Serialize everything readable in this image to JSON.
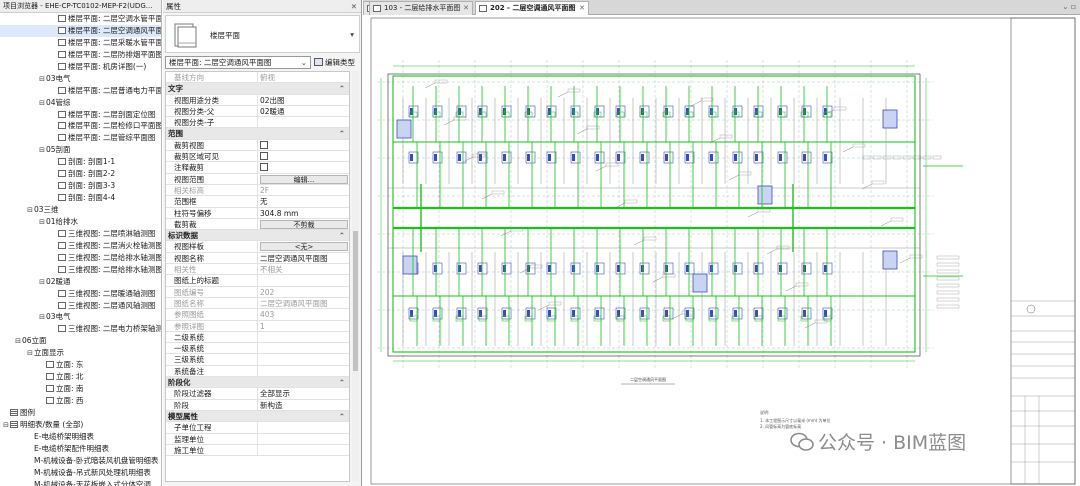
{
  "project_browser": {
    "title": "项目浏览器 - EHE-CP-TC0102-MEP-F2(UDG...",
    "items": [
      {
        "depth": 4,
        "icon": "view",
        "label": "楼层平面: 二层空调水管平面图"
      },
      {
        "depth": 4,
        "icon": "view",
        "label": "楼层平面: 二层空调通风平面图",
        "highlight": true
      },
      {
        "depth": 4,
        "icon": "view",
        "label": "楼层平面: 二层采暖水管平面图"
      },
      {
        "depth": 4,
        "icon": "view",
        "label": "楼层平面: 二层防排烟平面图"
      },
      {
        "depth": 4,
        "icon": "view",
        "label": "楼层平面: 机房详图(一)"
      },
      {
        "depth": 3,
        "icon": "expand",
        "label": "03电气"
      },
      {
        "depth": 4,
        "icon": "view",
        "label": "楼层平面: 二层普通电力平面图"
      },
      {
        "depth": 3,
        "icon": "expand",
        "label": "04管综"
      },
      {
        "depth": 4,
        "icon": "view",
        "label": "楼层平面: 二层剖面定位图"
      },
      {
        "depth": 4,
        "icon": "view",
        "label": "楼层平面: 二层检修口平面图"
      },
      {
        "depth": 4,
        "icon": "view",
        "label": "楼层平面: 二层管综平面图"
      },
      {
        "depth": 3,
        "icon": "expand",
        "label": "05剖面"
      },
      {
        "depth": 4,
        "icon": "view",
        "label": "剖面: 剖面1-1"
      },
      {
        "depth": 4,
        "icon": "view",
        "label": "剖面: 剖面2-2"
      },
      {
        "depth": 4,
        "icon": "view",
        "label": "剖面: 剖面3-3"
      },
      {
        "depth": 4,
        "icon": "view",
        "label": "剖面: 剖面4-4"
      },
      {
        "depth": 2,
        "icon": "expand",
        "label": "03三维"
      },
      {
        "depth": 3,
        "icon": "expand",
        "label": "01给排水"
      },
      {
        "depth": 4,
        "icon": "view",
        "label": "三维视图: 二层喷淋轴测图"
      },
      {
        "depth": 4,
        "icon": "view",
        "label": "三维视图: 二层消火栓轴测图"
      },
      {
        "depth": 4,
        "icon": "view",
        "label": "三维视图: 二层给排水轴测图"
      },
      {
        "depth": 4,
        "icon": "view",
        "label": "三维视图: 二层给排水轴测图 副本"
      },
      {
        "depth": 3,
        "icon": "expand",
        "label": "02暖通"
      },
      {
        "depth": 4,
        "icon": "view",
        "label": "三维视图: 二层暖通轴测图"
      },
      {
        "depth": 4,
        "icon": "view",
        "label": "三维视图: 二层通风轴测图"
      },
      {
        "depth": 3,
        "icon": "expand",
        "label": "03电气"
      },
      {
        "depth": 4,
        "icon": "view",
        "label": "三维视图: 二层电力桥架轴测图"
      },
      {
        "depth": 1,
        "icon": "expand",
        "label": "06立面"
      },
      {
        "depth": 2,
        "icon": "expand",
        "label": "立面显示"
      },
      {
        "depth": 3,
        "icon": "view",
        "label": "立面: 东"
      },
      {
        "depth": 3,
        "icon": "view",
        "label": "立面: 北"
      },
      {
        "depth": 3,
        "icon": "view",
        "label": "立面: 南"
      },
      {
        "depth": 3,
        "icon": "view",
        "label": "立面: 西"
      },
      {
        "depth": 0,
        "icon": "sched",
        "label": "图例"
      },
      {
        "depth": 0,
        "icon": "sched",
        "label": "明细表/数量 (全部)",
        "expand": true
      },
      {
        "depth": 2,
        "icon": "none",
        "label": "E-电缆桥架明细表"
      },
      {
        "depth": 2,
        "icon": "none",
        "label": "E-电缆桥架配件明细表"
      },
      {
        "depth": 2,
        "icon": "none",
        "label": "M-机械设备-卧式暗装风机盘管明细表"
      },
      {
        "depth": 2,
        "icon": "none",
        "label": "M-机械设备-吊式新风处理机明细表"
      },
      {
        "depth": 2,
        "icon": "none",
        "label": "M-机械设备-天花板嵌入式分体空调"
      }
    ]
  },
  "properties": {
    "title": "属性",
    "type_name": "楼层平面",
    "instance_filter": "楼层平面: 二层空调通风平面图",
    "edit_type": "编辑类型",
    "rows": [
      {
        "kind": "prop",
        "key": "基线方向",
        "value": "俯视",
        "grey": true
      },
      {
        "kind": "cat",
        "key": "文字"
      },
      {
        "kind": "prop",
        "key": "视图用途分类",
        "value": "02出图"
      },
      {
        "kind": "prop",
        "key": "视图分类-父",
        "value": "02暖通"
      },
      {
        "kind": "prop",
        "key": "视图分类-子",
        "value": ""
      },
      {
        "kind": "cat",
        "key": "范围"
      },
      {
        "kind": "check",
        "key": "裁剪视图"
      },
      {
        "kind": "check",
        "key": "裁剪区域可见"
      },
      {
        "kind": "check",
        "key": "注释裁剪"
      },
      {
        "kind": "button",
        "key": "视图范围",
        "value": "编辑..."
      },
      {
        "kind": "prop",
        "key": "相关标高",
        "value": "2F",
        "grey": true
      },
      {
        "kind": "prop",
        "key": "范围框",
        "value": "无"
      },
      {
        "kind": "prop",
        "key": "柱符号偏移",
        "value": "304.8 mm"
      },
      {
        "kind": "button",
        "key": "截剪裁",
        "value": "不剪裁"
      },
      {
        "kind": "cat",
        "key": "标识数据"
      },
      {
        "kind": "button",
        "key": "视图样板",
        "value": "<无>"
      },
      {
        "kind": "prop",
        "key": "视图名称",
        "value": "二层空调通风平面图"
      },
      {
        "kind": "prop",
        "key": "相关性",
        "value": "不相关",
        "grey": true
      },
      {
        "kind": "prop",
        "key": "图纸上的标题",
        "value": ""
      },
      {
        "kind": "prop",
        "key": "图纸编号",
        "value": "202",
        "grey": true
      },
      {
        "kind": "prop",
        "key": "图纸名称",
        "value": "二层空调通风平面图",
        "grey": true
      },
      {
        "kind": "prop",
        "key": "参照图纸",
        "value": "403",
        "grey": true
      },
      {
        "kind": "prop",
        "key": "参照详图",
        "value": "1",
        "grey": true
      },
      {
        "kind": "prop",
        "key": "二级系统",
        "value": ""
      },
      {
        "kind": "prop",
        "key": "一级系统",
        "value": ""
      },
      {
        "kind": "prop",
        "key": "三级系统",
        "value": ""
      },
      {
        "kind": "prop",
        "key": "系统备注",
        "value": ""
      },
      {
        "kind": "cat",
        "key": "阶段化"
      },
      {
        "kind": "prop",
        "key": "阶段过滤器",
        "value": "全部显示"
      },
      {
        "kind": "prop",
        "key": "阶段",
        "value": "新构造"
      },
      {
        "kind": "cat",
        "key": "模型属性"
      },
      {
        "kind": "prop",
        "key": "子单位工程",
        "value": ""
      },
      {
        "kind": "prop",
        "key": "监理单位",
        "value": ""
      },
      {
        "kind": "prop",
        "key": "施工单位",
        "value": ""
      }
    ]
  },
  "tabs": [
    {
      "label": "...",
      "active": false
    },
    {
      "label": "103 - 二层给排水平面图",
      "active": false
    },
    {
      "label": "202 - 二层空调通风平面图",
      "active": true
    }
  ],
  "drawing": {
    "view_title": "二层空调通风平面图",
    "notes_heading": "说明:",
    "note_1": "1. 本工程图示尺寸以毫米 (mm) 为单位",
    "note_2": "2. 风管标高为管底标高"
  },
  "watermark": {
    "text": "公众号 · BIM蓝图"
  },
  "colors": {
    "duct": "#19c21b",
    "equipment": "#3a4fb4",
    "selection": "#dbe9fb"
  }
}
